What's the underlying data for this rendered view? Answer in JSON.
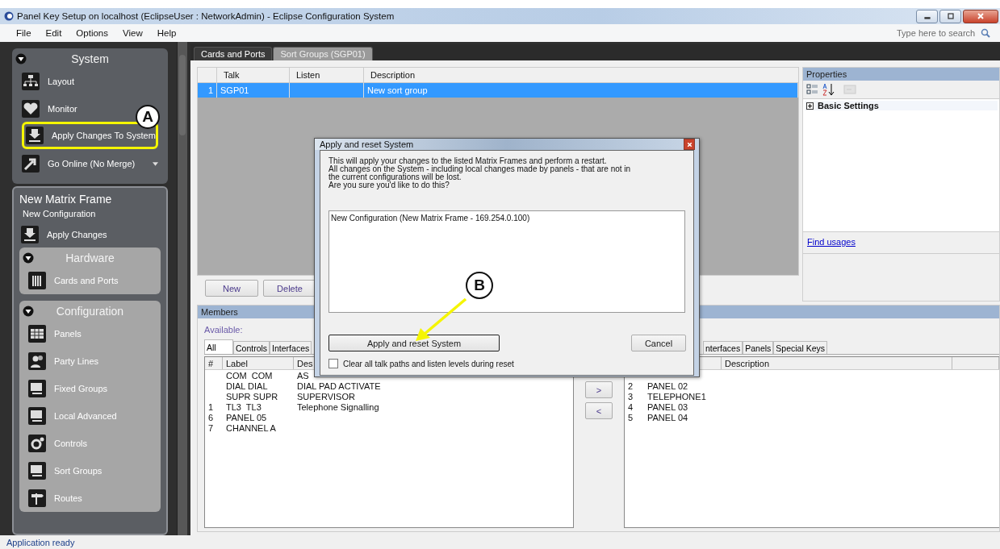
{
  "window": {
    "title": "Panel Key Setup on localhost (EclipseUser : NetworkAdmin) - Eclipse Configuration System"
  },
  "menu": [
    "File",
    "Edit",
    "Options",
    "View",
    "Help"
  ],
  "search": {
    "placeholder": "Type here to search"
  },
  "sidebar": {
    "system": {
      "title": "System",
      "expanded": true,
      "items": [
        {
          "label": "Layout"
        },
        {
          "label": "Monitor"
        },
        {
          "label": "Apply Changes To System",
          "annotation": "A"
        },
        {
          "label": "Go Online (No Merge)",
          "dropdown": true
        }
      ]
    },
    "frame": {
      "title": "New Matrix Frame",
      "subtitle": "New Configuration",
      "action": "Apply Changes",
      "groups": [
        {
          "title": "Hardware",
          "expanded": true,
          "items": [
            "Cards and Ports"
          ]
        },
        {
          "title": "Configuration",
          "expanded": true,
          "items": [
            "Panels",
            "Party Lines",
            "Fixed Groups",
            "Local Advanced",
            "Controls",
            "Sort Groups",
            "Routes"
          ]
        }
      ]
    }
  },
  "doc_tabs": [
    {
      "label": "Cards and Ports",
      "selected": false
    },
    {
      "label": "Sort Groups (SGP01)",
      "selected": true
    }
  ],
  "grid": {
    "columns": [
      "Talk",
      "Listen",
      "Description"
    ],
    "rows": [
      {
        "number": "1",
        "talk": "SGP01",
        "description": "New sort group",
        "selected": true
      }
    ]
  },
  "grid_buttons": [
    "New",
    "Delete"
  ],
  "properties": {
    "title": "Properties",
    "groups": [
      {
        "label": "Basic Settings",
        "expanded": false
      }
    ],
    "link": "Find usages"
  },
  "members": {
    "title": "Members",
    "available_label": "Available:",
    "available_tabs": [
      {
        "label": "All",
        "selected": true
      },
      {
        "label": "Controls",
        "selected": false
      },
      {
        "label": "Interfaces",
        "selected": false
      }
    ],
    "available_columns": [
      "#",
      "Label",
      "Des"
    ],
    "available_rows": [
      {
        "label": "COM  COM",
        "description": "AS"
      },
      {
        "label": "DIAL DIAL",
        "description": "DIAL PAD ACTIVATE"
      },
      {
        "label": "SUPR SUPR",
        "description": "SUPERVISOR"
      },
      {
        "number": "1",
        "label": "TL3  TL3",
        "description": "Telephone Signalling"
      },
      {
        "number": "6",
        "label": "PANEL 05"
      },
      {
        "number": "7",
        "label": "CHANNEL A"
      }
    ],
    "move_buttons": [
      ">",
      "<"
    ],
    "member_tabs": [
      {
        "label": "nterfaces",
        "selected": false
      },
      {
        "label": "Panels",
        "selected": false
      },
      {
        "label": "Special Keys",
        "selected": false
      }
    ],
    "member_columns": [
      "Description"
    ],
    "member_rows": [
      {
        "number": "2",
        "label": "PANEL 02"
      },
      {
        "number": "3",
        "label": "TELEPHONE1"
      },
      {
        "number": "4",
        "label": "PANEL 03"
      },
      {
        "number": "5",
        "label": "PANEL 04"
      }
    ]
  },
  "dialog": {
    "title": "Apply and reset System",
    "message": "This will apply your changes to the listed Matrix Frames and perform a restart.\nAll changes on the System - including local changes made by panels - that are not in\nthe current configurations will be lost.\nAre you sure you'd like to do this?",
    "frames": [
      "New Configuration (New Matrix Frame - 169.254.0.100)"
    ],
    "apply_button": {
      "label": "Apply and reset System",
      "annotation": "B"
    },
    "cancel_button": "Cancel",
    "clear_checkbox": {
      "label": "Clear all talk paths and listen levels during reset",
      "checked": false
    }
  },
  "status_bar": "Application ready"
}
